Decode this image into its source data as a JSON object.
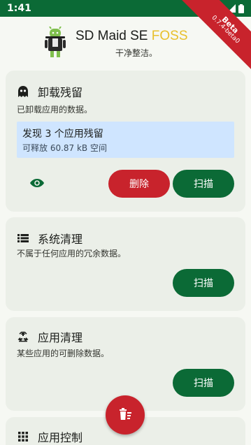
{
  "status_bar": {
    "time": "1:41"
  },
  "ribbon": {
    "label": "Beta",
    "version": "0.7.4-beta0"
  },
  "header": {
    "title_main": "SD Maid SE ",
    "title_accent": "FOSS",
    "subtitle": "干净整洁。"
  },
  "cards": {
    "app_leftovers": {
      "title": "卸载残留",
      "description": "已卸载应用的数据。",
      "result_title": "发现 3 个应用残留",
      "result_subtitle": "可释放 60.87 kB 空间",
      "delete_label": "删除",
      "scan_label": "扫描",
      "icon": "ghost-icon"
    },
    "system_cleaner": {
      "title": "系统清理",
      "description": "不属于任何应用的冗余数据。",
      "scan_label": "扫描",
      "icon": "list-icon"
    },
    "app_cleaner": {
      "title": "应用清理",
      "description": "某些应用的可删除数据。",
      "scan_label": "扫描",
      "icon": "recycle-icon"
    },
    "app_control": {
      "title": "应用控制",
      "icon": "grid-icon"
    }
  },
  "fab": {
    "icon": "delete-sweep-icon"
  },
  "colors": {
    "primary": "#0b6a36",
    "danger": "#c8232c",
    "accent": "#e8c02c",
    "card_bg": "#ebefe8",
    "result_bg": "#cfe5ff"
  }
}
